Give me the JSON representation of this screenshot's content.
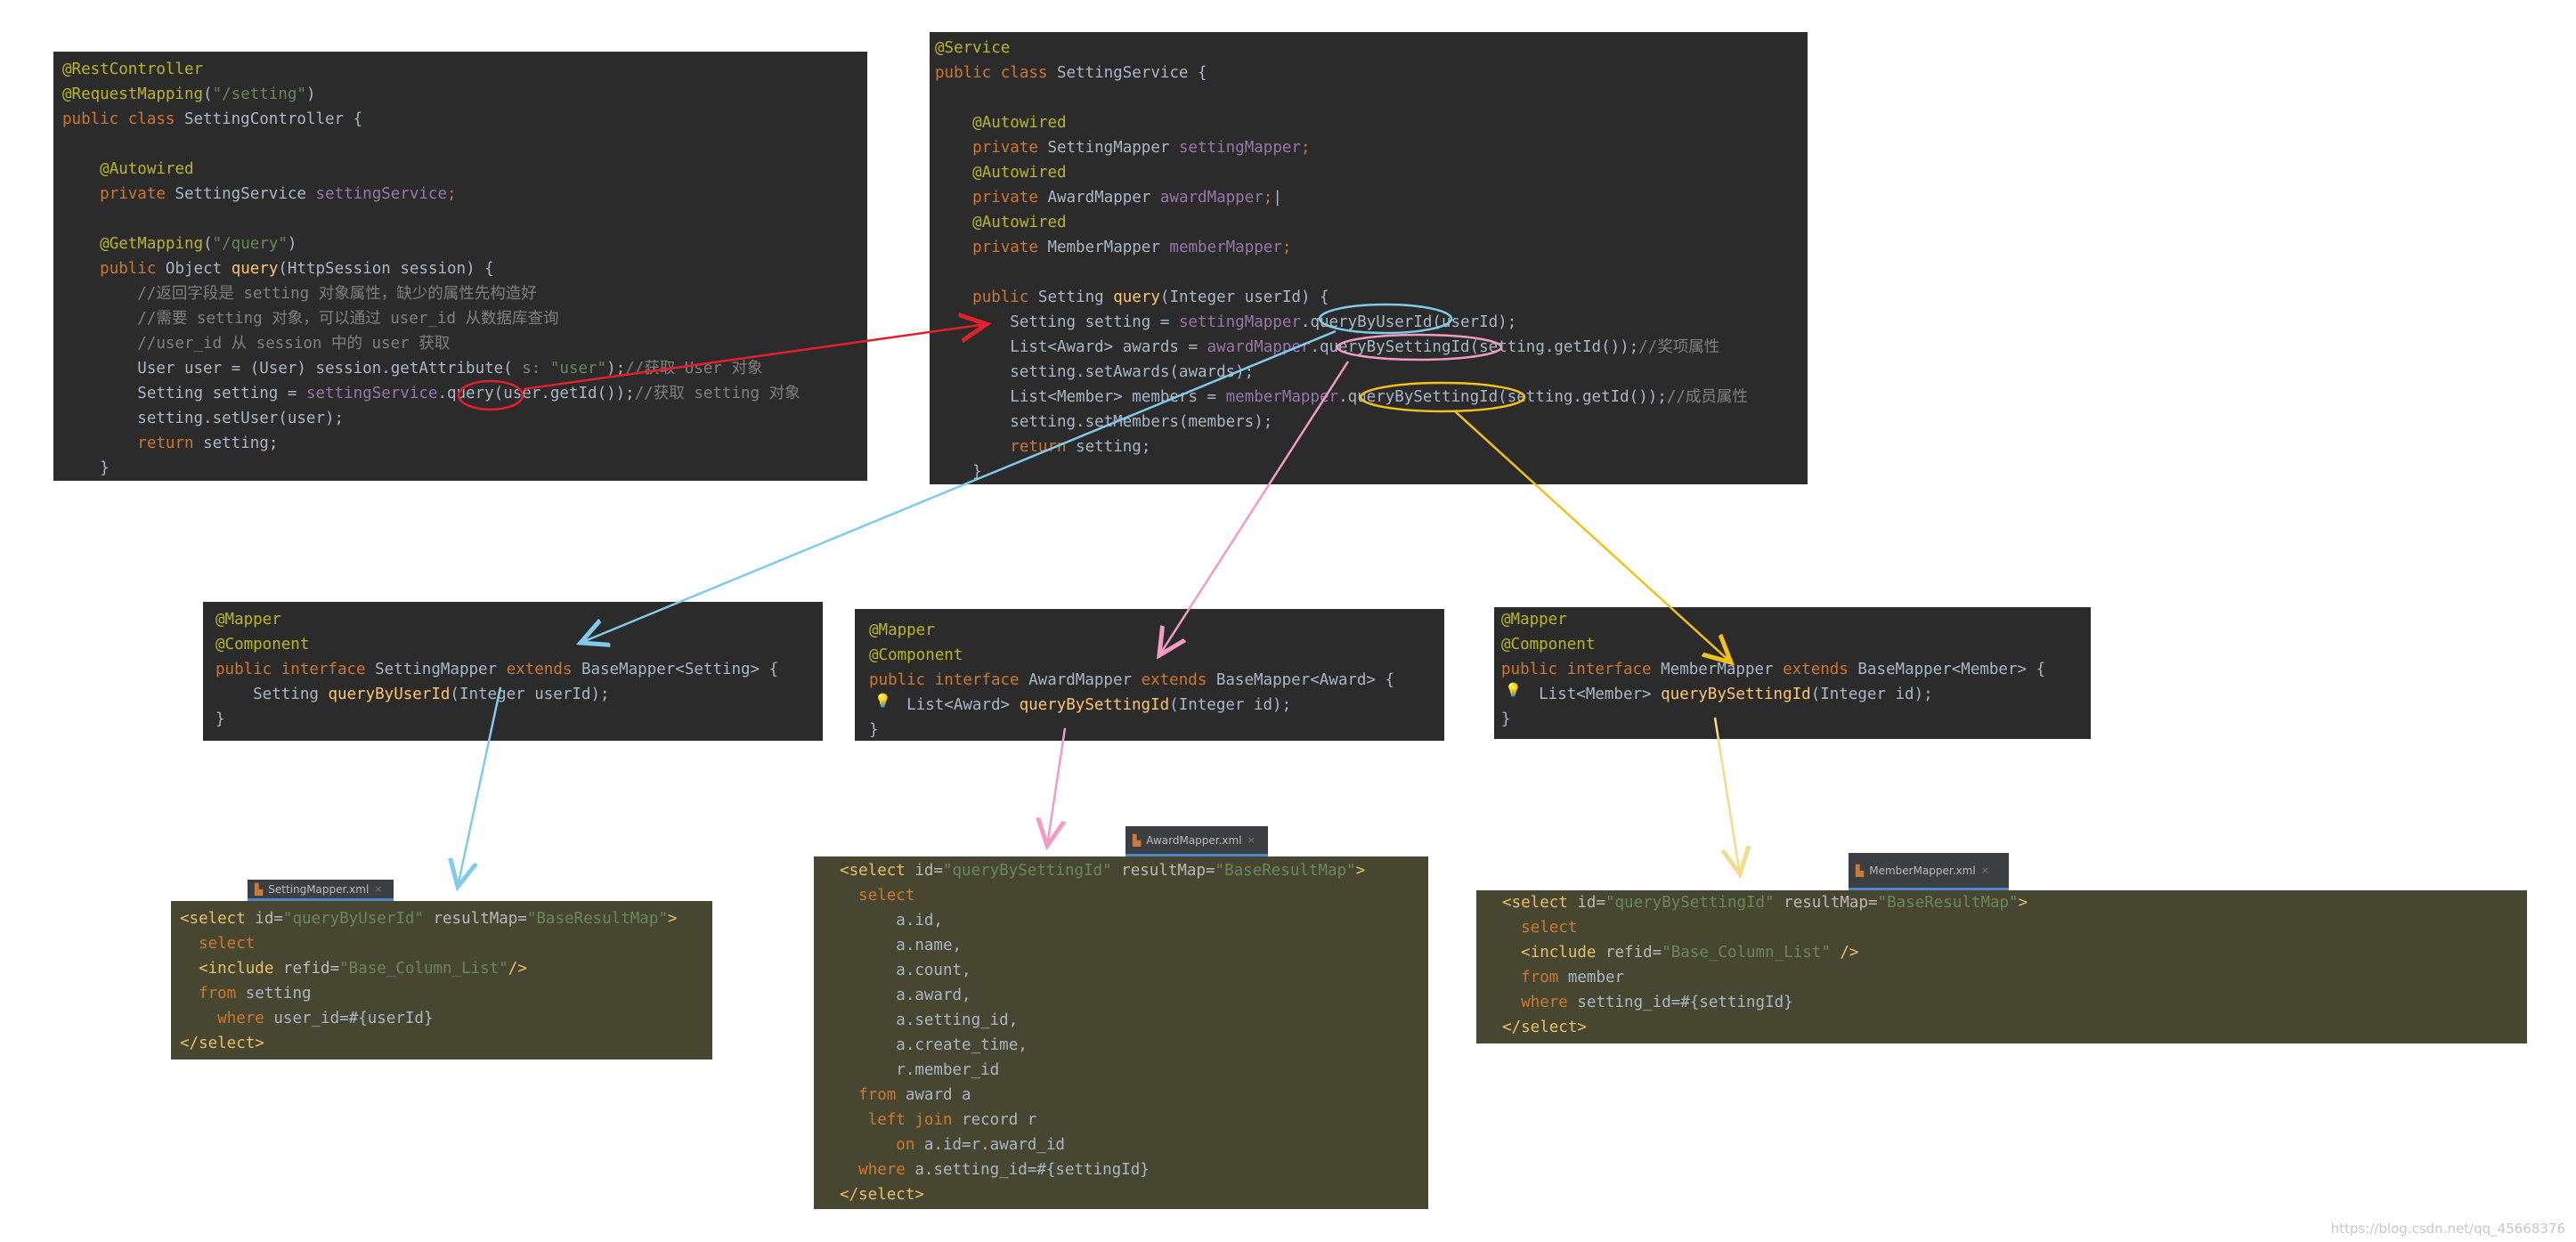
{
  "controller": {
    "lines": [
      [
        [
          "ann",
          "@RestController"
        ]
      ],
      [
        [
          "ann",
          "@RequestMapping"
        ],
        [
          "def",
          "("
        ],
        [
          "str",
          "\"/setting\""
        ],
        [
          "def",
          ")"
        ]
      ],
      [
        [
          "kw",
          "public class "
        ],
        [
          "def",
          "SettingController {"
        ]
      ],
      [],
      [
        [
          "def",
          "    "
        ],
        [
          "ann",
          "@Autowired"
        ]
      ],
      [
        [
          "def",
          "    "
        ],
        [
          "kw",
          "private "
        ],
        [
          "def",
          "SettingService "
        ],
        [
          "fld",
          "settingService"
        ],
        [
          "kw",
          ";"
        ]
      ],
      [],
      [
        [
          "def",
          "    "
        ],
        [
          "ann",
          "@GetMapping"
        ],
        [
          "def",
          "("
        ],
        [
          "str",
          "\"/query\""
        ],
        [
          "def",
          ")"
        ]
      ],
      [
        [
          "def",
          "    "
        ],
        [
          "kw",
          "public "
        ],
        [
          "def",
          "Object "
        ],
        [
          "fn",
          "query"
        ],
        [
          "def",
          "(HttpSession session) {"
        ]
      ],
      [
        [
          "def",
          "        "
        ],
        [
          "cmt",
          "//返回字段是 setting 对象属性，缺少的属性先构造好"
        ]
      ],
      [
        [
          "def",
          "        "
        ],
        [
          "cmt",
          "//需要 setting 对象，可以通过 user_id 从数据库查询"
        ]
      ],
      [
        [
          "def",
          "        "
        ],
        [
          "cmt",
          "//user_id 从 session 中的 user 获取"
        ]
      ],
      [
        [
          "def",
          "        User user = (User) session.getAttribute( "
        ],
        [
          "cmt",
          "s: "
        ],
        [
          "str",
          "\"user\""
        ],
        [
          "def",
          ");"
        ],
        [
          "cmt",
          "//获取 User 对象"
        ]
      ],
      [
        [
          "def",
          "        Setting setting = "
        ],
        [
          "fld",
          "settingService"
        ],
        [
          "def",
          ".query(user.getId());"
        ],
        [
          "cmt",
          "//获取 setting 对象"
        ]
      ],
      [
        [
          "def",
          "        setting.setUser(user);"
        ]
      ],
      [
        [
          "def",
          "        "
        ],
        [
          "kw",
          "return "
        ],
        [
          "def",
          "setting;"
        ]
      ],
      [
        [
          "def",
          "    }"
        ]
      ]
    ]
  },
  "service": {
    "lines": [
      [
        [
          "ann",
          "@Service"
        ]
      ],
      [
        [
          "kw",
          "public class "
        ],
        [
          "def",
          "SettingService {"
        ]
      ],
      [],
      [
        [
          "def",
          "    "
        ],
        [
          "ann",
          "@Autowired"
        ]
      ],
      [
        [
          "def",
          "    "
        ],
        [
          "kw",
          "private "
        ],
        [
          "def",
          "SettingMapper "
        ],
        [
          "fld",
          "settingMapper"
        ],
        [
          "kw",
          ";"
        ]
      ],
      [
        [
          "def",
          "    "
        ],
        [
          "ann",
          "@Autowired"
        ]
      ],
      [
        [
          "def",
          "    "
        ],
        [
          "kw",
          "private "
        ],
        [
          "def",
          "AwardMapper "
        ],
        [
          "fld",
          "awardMapper"
        ],
        [
          "kw",
          ";"
        ],
        [
          "def",
          "|"
        ]
      ],
      [
        [
          "def",
          "    "
        ],
        [
          "ann",
          "@Autowired"
        ]
      ],
      [
        [
          "def",
          "    "
        ],
        [
          "kw",
          "private "
        ],
        [
          "def",
          "MemberMapper "
        ],
        [
          "fld",
          "memberMapper"
        ],
        [
          "kw",
          ";"
        ]
      ],
      [],
      [
        [
          "def",
          "    "
        ],
        [
          "kw",
          "public "
        ],
        [
          "def",
          "Setting "
        ],
        [
          "fn",
          "query"
        ],
        [
          "def",
          "(Integer userId) {"
        ]
      ],
      [
        [
          "def",
          "        Setting setting = "
        ],
        [
          "fld",
          "settingMapper"
        ],
        [
          "def",
          ".queryByUserId(userId);"
        ]
      ],
      [
        [
          "def",
          "        List<Award> awards = "
        ],
        [
          "fld",
          "awardMapper"
        ],
        [
          "def",
          ".queryBySettingId(setting.getId());"
        ],
        [
          "cmt",
          "//奖项属性"
        ]
      ],
      [
        [
          "def",
          "        setting.setAwards(awards);"
        ]
      ],
      [
        [
          "def",
          "        List<Member> members = "
        ],
        [
          "fld",
          "memberMapper"
        ],
        [
          "def",
          ".queryBySettingId(setting.getId());"
        ],
        [
          "cmt",
          "//成员属性"
        ]
      ],
      [
        [
          "def",
          "        setting.setMembers(members);"
        ]
      ],
      [
        [
          "def",
          "        "
        ],
        [
          "kw",
          "return "
        ],
        [
          "def",
          "setting;"
        ]
      ],
      [
        [
          "def",
          "    }"
        ]
      ]
    ]
  },
  "setting_mapper": {
    "lines": [
      [
        [
          "ann",
          "@Mapper"
        ]
      ],
      [
        [
          "ann",
          "@Component"
        ]
      ],
      [
        [
          "kw",
          "public interface "
        ],
        [
          "def",
          "SettingMapper "
        ],
        [
          "kw",
          "extends "
        ],
        [
          "def",
          "BaseMapper<Setting> {"
        ]
      ],
      [
        [
          "def",
          "    Setting "
        ],
        [
          "fn",
          "queryByUserId"
        ],
        [
          "def",
          "(Integer userId);"
        ]
      ],
      [
        [
          "def",
          "}"
        ]
      ]
    ]
  },
  "award_mapper": {
    "lines": [
      [
        [
          "ann",
          "@Mapper"
        ]
      ],
      [
        [
          "ann",
          "@Component"
        ]
      ],
      [
        [
          "kw",
          "public interface "
        ],
        [
          "def",
          "AwardMapper "
        ],
        [
          "kw",
          "extends "
        ],
        [
          "def",
          "BaseMapper<Award> {"
        ]
      ],
      [
        [
          "def",
          "    List<Award> "
        ],
        [
          "fn",
          "queryBySettingId"
        ],
        [
          "def",
          "(Integer id);"
        ]
      ],
      [
        [
          "def",
          "}"
        ]
      ]
    ]
  },
  "member_mapper": {
    "lines": [
      [
        [
          "ann",
          "@Mapper"
        ]
      ],
      [
        [
          "ann",
          "@Component"
        ]
      ],
      [
        [
          "kw",
          "public interface "
        ],
        [
          "def",
          "MemberMapper "
        ],
        [
          "kw",
          "extends "
        ],
        [
          "def",
          "BaseMapper<Member> {"
        ]
      ],
      [
        [
          "def",
          "    List<Member> "
        ],
        [
          "fn",
          "queryBySettingId"
        ],
        [
          "def",
          "(Integer id);"
        ]
      ],
      [
        [
          "def",
          "}"
        ]
      ]
    ]
  },
  "setting_xml": {
    "tab": "SettingMapper.xml",
    "lines": [
      [
        [
          "tag",
          "<select "
        ],
        [
          "attr",
          "id="
        ],
        [
          "val",
          "\"queryByUserId\""
        ],
        [
          "attr",
          " resultMap="
        ],
        [
          "val",
          "\"BaseResultMap\""
        ],
        [
          "tag",
          ">"
        ]
      ],
      [
        [
          "def",
          "  "
        ],
        [
          "sqk",
          "select"
        ]
      ],
      [
        [
          "def",
          "  "
        ],
        [
          "tag",
          "<include "
        ],
        [
          "attr",
          "refid="
        ],
        [
          "val",
          "\"Base_Column_List\""
        ],
        [
          "tag",
          "/>"
        ]
      ],
      [
        [
          "def",
          "  "
        ],
        [
          "sqk",
          "from "
        ],
        [
          "def",
          "setting"
        ]
      ],
      [
        [
          "def",
          "    "
        ],
        [
          "sqk",
          "where "
        ],
        [
          "def",
          "user_id=#{userId}"
        ]
      ],
      [
        [
          "tag",
          "</select>"
        ]
      ]
    ]
  },
  "award_xml": {
    "tab": "AwardMapper.xml",
    "lines": [
      [
        [
          "def",
          "  "
        ],
        [
          "tag",
          "<select "
        ],
        [
          "attr",
          "id="
        ],
        [
          "val",
          "\"queryBySettingId\""
        ],
        [
          "attr",
          " resultMap="
        ],
        [
          "val",
          "\"BaseResultMap\""
        ],
        [
          "tag",
          ">"
        ]
      ],
      [
        [
          "def",
          "    "
        ],
        [
          "sqk",
          "select"
        ]
      ],
      [
        [
          "def",
          "        a.id,"
        ]
      ],
      [
        [
          "def",
          "        a.name,"
        ]
      ],
      [
        [
          "def",
          "        a.count,"
        ]
      ],
      [
        [
          "def",
          "        a.award,"
        ]
      ],
      [
        [
          "def",
          "        a.setting_id,"
        ]
      ],
      [
        [
          "def",
          "        a.create_time,"
        ]
      ],
      [
        [
          "def",
          "        r.member_id"
        ]
      ],
      [
        [
          "def",
          "    "
        ],
        [
          "sqk",
          "from "
        ],
        [
          "def",
          "award a"
        ]
      ],
      [
        [
          "def",
          "     "
        ],
        [
          "sqk",
          "left join "
        ],
        [
          "def",
          "record r"
        ]
      ],
      [
        [
          "def",
          "        "
        ],
        [
          "sqk",
          "on "
        ],
        [
          "def",
          "a.id=r.award_id"
        ]
      ],
      [
        [
          "def",
          "    "
        ],
        [
          "sqk",
          "where "
        ],
        [
          "def",
          "a.setting_id=#{settingId}"
        ]
      ],
      [
        [
          "def",
          "  "
        ],
        [
          "tag",
          "</select>"
        ]
      ]
    ]
  },
  "member_xml": {
    "tab": "MemberMapper.xml",
    "lines": [
      [
        [
          "def",
          "  "
        ],
        [
          "tag",
          "<select "
        ],
        [
          "attr",
          "id="
        ],
        [
          "val",
          "\"queryBySettingId\""
        ],
        [
          "attr",
          " resultMap="
        ],
        [
          "val",
          "\"BaseResultMap\""
        ],
        [
          "tag",
          ">"
        ]
      ],
      [
        [
          "def",
          "    "
        ],
        [
          "sqk",
          "select"
        ]
      ],
      [
        [
          "def",
          "    "
        ],
        [
          "tag",
          "<include "
        ],
        [
          "attr",
          "refid="
        ],
        [
          "val",
          "\"Base_Column_List\""
        ],
        [
          "tag",
          " />"
        ]
      ],
      [
        [
          "def",
          "    "
        ],
        [
          "sqk",
          "from "
        ],
        [
          "def",
          "member"
        ]
      ],
      [
        [
          "def",
          "    "
        ],
        [
          "sqk",
          "where "
        ],
        [
          "def",
          "setting_id=#{settingId}"
        ]
      ],
      [
        [
          "def",
          "  "
        ],
        [
          "tag",
          "</select>"
        ]
      ]
    ]
  },
  "colors": {
    "red": "#e0202a",
    "blue": "#7fcbe8",
    "pink": "#f29bc4",
    "yellow": "#f2c21a",
    "light_yellow": "#f3dc8a",
    "white": "#ffffff"
  },
  "watermark": "https://blog.csdn.net/qq_45668376"
}
